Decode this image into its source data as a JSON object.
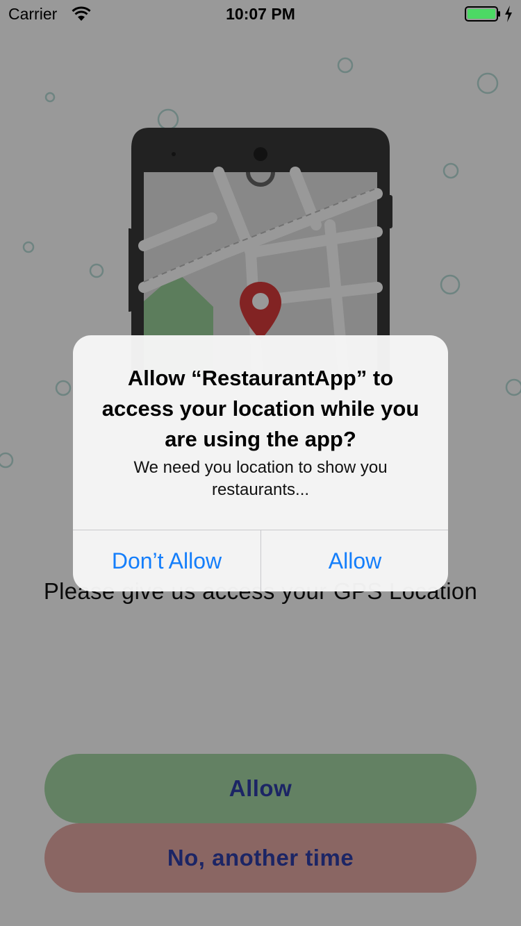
{
  "status_bar": {
    "carrier": "Carrier",
    "time": "10:07 PM"
  },
  "screen": {
    "message": "Please give us access your GPS Location",
    "allow_label": "Allow",
    "later_label": "No, another time"
  },
  "alert": {
    "title": "Allow “RestaurantApp” to access your location while you are using the app?",
    "message": "We need you location to show you restaurants...",
    "dont_allow_label": "Don’t Allow",
    "allow_label": "Allow"
  },
  "colors": {
    "accent_blue": "#147efb",
    "allow_button": "#a6d7a6",
    "later_button": "#e7aaa5",
    "button_text": "#2f3fa8",
    "battery_green": "#4cd964",
    "pin_red": "#d93b3b"
  },
  "icons": [
    "wifi-icon",
    "battery-icon",
    "charging-bolt-icon",
    "location-pin-icon"
  ]
}
